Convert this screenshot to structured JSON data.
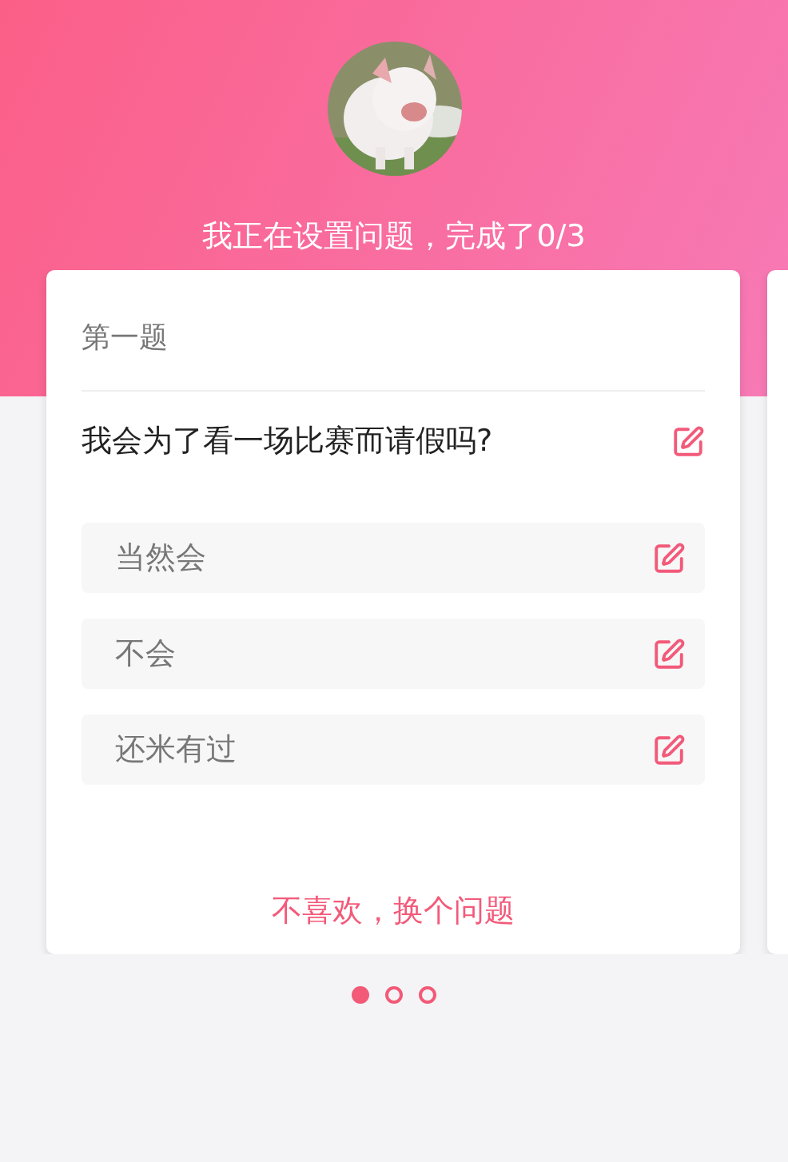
{
  "header": {
    "progress_text": "我正在设置问题，完成了0/3"
  },
  "cards": [
    {
      "number_label": "第一题",
      "question": "我会为了看一场比赛而请假吗?",
      "options": [
        {
          "text": "当然会"
        },
        {
          "text": "不会"
        },
        {
          "text": "还米有过"
        }
      ],
      "change_link": "不喜欢，换个问题"
    }
  ],
  "pager": [
    {
      "selected": true
    },
    {
      "selected": false
    },
    {
      "selected": false
    }
  ]
}
